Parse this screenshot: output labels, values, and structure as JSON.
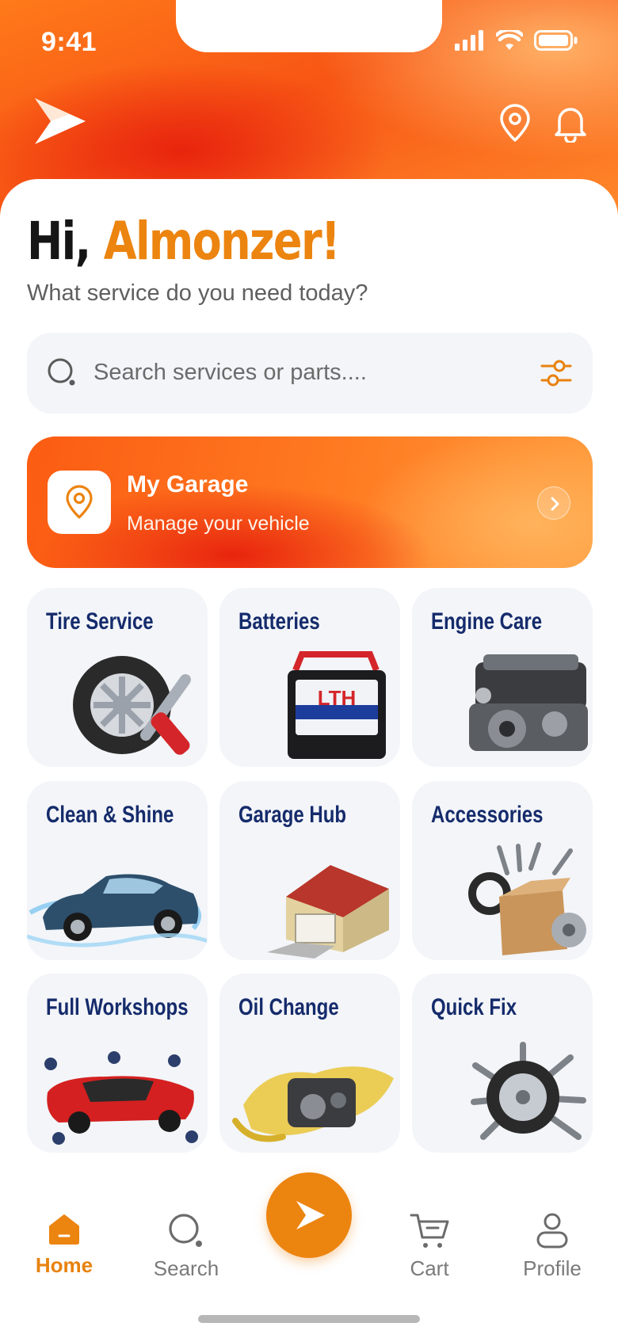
{
  "status_bar": {
    "time": "9:41"
  },
  "header": {
    "icons": [
      "play-logo-icon",
      "location-pin-icon",
      "bell-icon"
    ]
  },
  "greeting": {
    "prefix": "Hi,",
    "name": "Almonzer!",
    "subtitle": "What service do you need today?"
  },
  "search": {
    "placeholder": "Search services or parts...."
  },
  "garage": {
    "title": "My Garage",
    "subtitle": "Manage your vehicle"
  },
  "services": [
    {
      "label": "Tire Service",
      "icon": "tire-wrench-image"
    },
    {
      "label": "Batteries",
      "icon": "battery-image"
    },
    {
      "label": "Engine Care",
      "icon": "engine-image"
    },
    {
      "label": "Clean & Shine",
      "icon": "car-wash-image"
    },
    {
      "label": "Garage Hub",
      "icon": "garage-house-image"
    },
    {
      "label": "Accessories",
      "icon": "parts-box-image"
    },
    {
      "label": "Full Workshops",
      "icon": "workshop-car-image"
    },
    {
      "label": "Oil Change",
      "icon": "oil-engine-image"
    },
    {
      "label": "Quick Fix",
      "icon": "wheel-parts-image"
    }
  ],
  "bottom_nav": {
    "home": "Home",
    "search": "Search",
    "cart": "Cart",
    "profile": "Profile",
    "active": "home"
  },
  "colors": {
    "accent": "#ec8410",
    "header_orange": "#f75514",
    "tile_bg": "#f3f5f9",
    "tile_label": "#152b6b"
  }
}
